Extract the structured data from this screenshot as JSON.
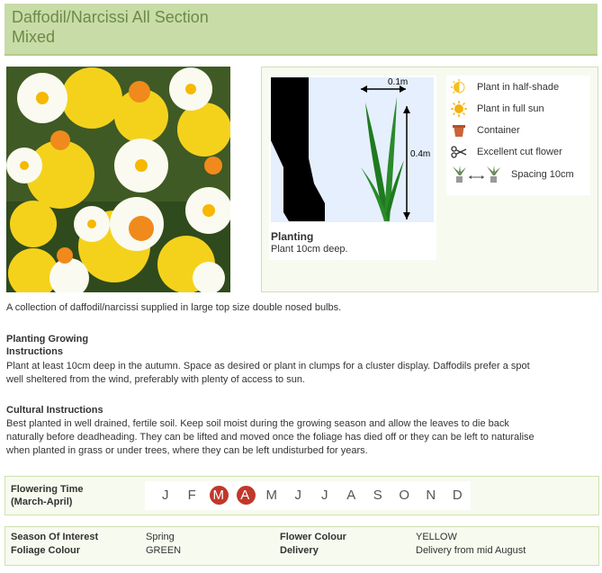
{
  "title": {
    "line1": "Daffodil/Narcissi All Section",
    "line2": "Mixed"
  },
  "diagram": {
    "width_label": "0.1m",
    "height_label": "0.4m"
  },
  "planting": {
    "title": "Planting",
    "text": "Plant 10cm deep."
  },
  "legend": [
    {
      "icon": "half-shade-icon",
      "label": "Plant in half-shade"
    },
    {
      "icon": "full-sun-icon",
      "label": "Plant in full sun"
    },
    {
      "icon": "container-icon",
      "label": "Container"
    },
    {
      "icon": "scissors-icon",
      "label": "Excellent cut flower"
    },
    {
      "icon": "spacing-icon",
      "label": "Spacing 10cm"
    }
  ],
  "description": "A collection of daffodil/narcissi supplied in large top size double nosed bulbs.",
  "growing": {
    "heading1": "Planting Growing",
    "heading2": "Instructions",
    "line1": "Plant at least 10cm deep in the autumn. Space as desired or plant in clumps for a cluster display. Daffodils prefer a spot",
    "line2": "well sheltered from the wind, preferably with plenty of access to sun."
  },
  "cultural": {
    "heading": "Cultural Instructions",
    "line1": "Best planted in well drained, fertile soil. Keep soil moist during the growing season and allow the leaves to die back",
    "line2": "naturally before deadheading. They can be lifted and moved once the foliage has died off or they can be left to naturalise",
    "line3": "when planted in grass or under trees, where they can be left undisturbed for years."
  },
  "flowering": {
    "label1": "Flowering Time",
    "label2": "(March-April)",
    "months": [
      {
        "m": "J",
        "active": false
      },
      {
        "m": "F",
        "active": false
      },
      {
        "m": "M",
        "active": true
      },
      {
        "m": "A",
        "active": true
      },
      {
        "m": "M",
        "active": false
      },
      {
        "m": "J",
        "active": false
      },
      {
        "m": "J",
        "active": false
      },
      {
        "m": "A",
        "active": false
      },
      {
        "m": "S",
        "active": false
      },
      {
        "m": "O",
        "active": false
      },
      {
        "m": "N",
        "active": false
      },
      {
        "m": "D",
        "active": false
      }
    ],
    "highlight_color": "#c0382b"
  },
  "details": {
    "season_label": "Season Of Interest",
    "season_value": "Spring",
    "flower_colour_label": "Flower Colour",
    "flower_colour_value": "YELLOW",
    "foliage_label": "Foliage Colour",
    "foliage_value": "GREEN",
    "delivery_label": "Delivery",
    "delivery_value": "Delivery from mid August"
  },
  "colors": {
    "title_bg": "#c8dca7",
    "title_text": "#6c8a48",
    "box_border": "#cfe0b0"
  }
}
